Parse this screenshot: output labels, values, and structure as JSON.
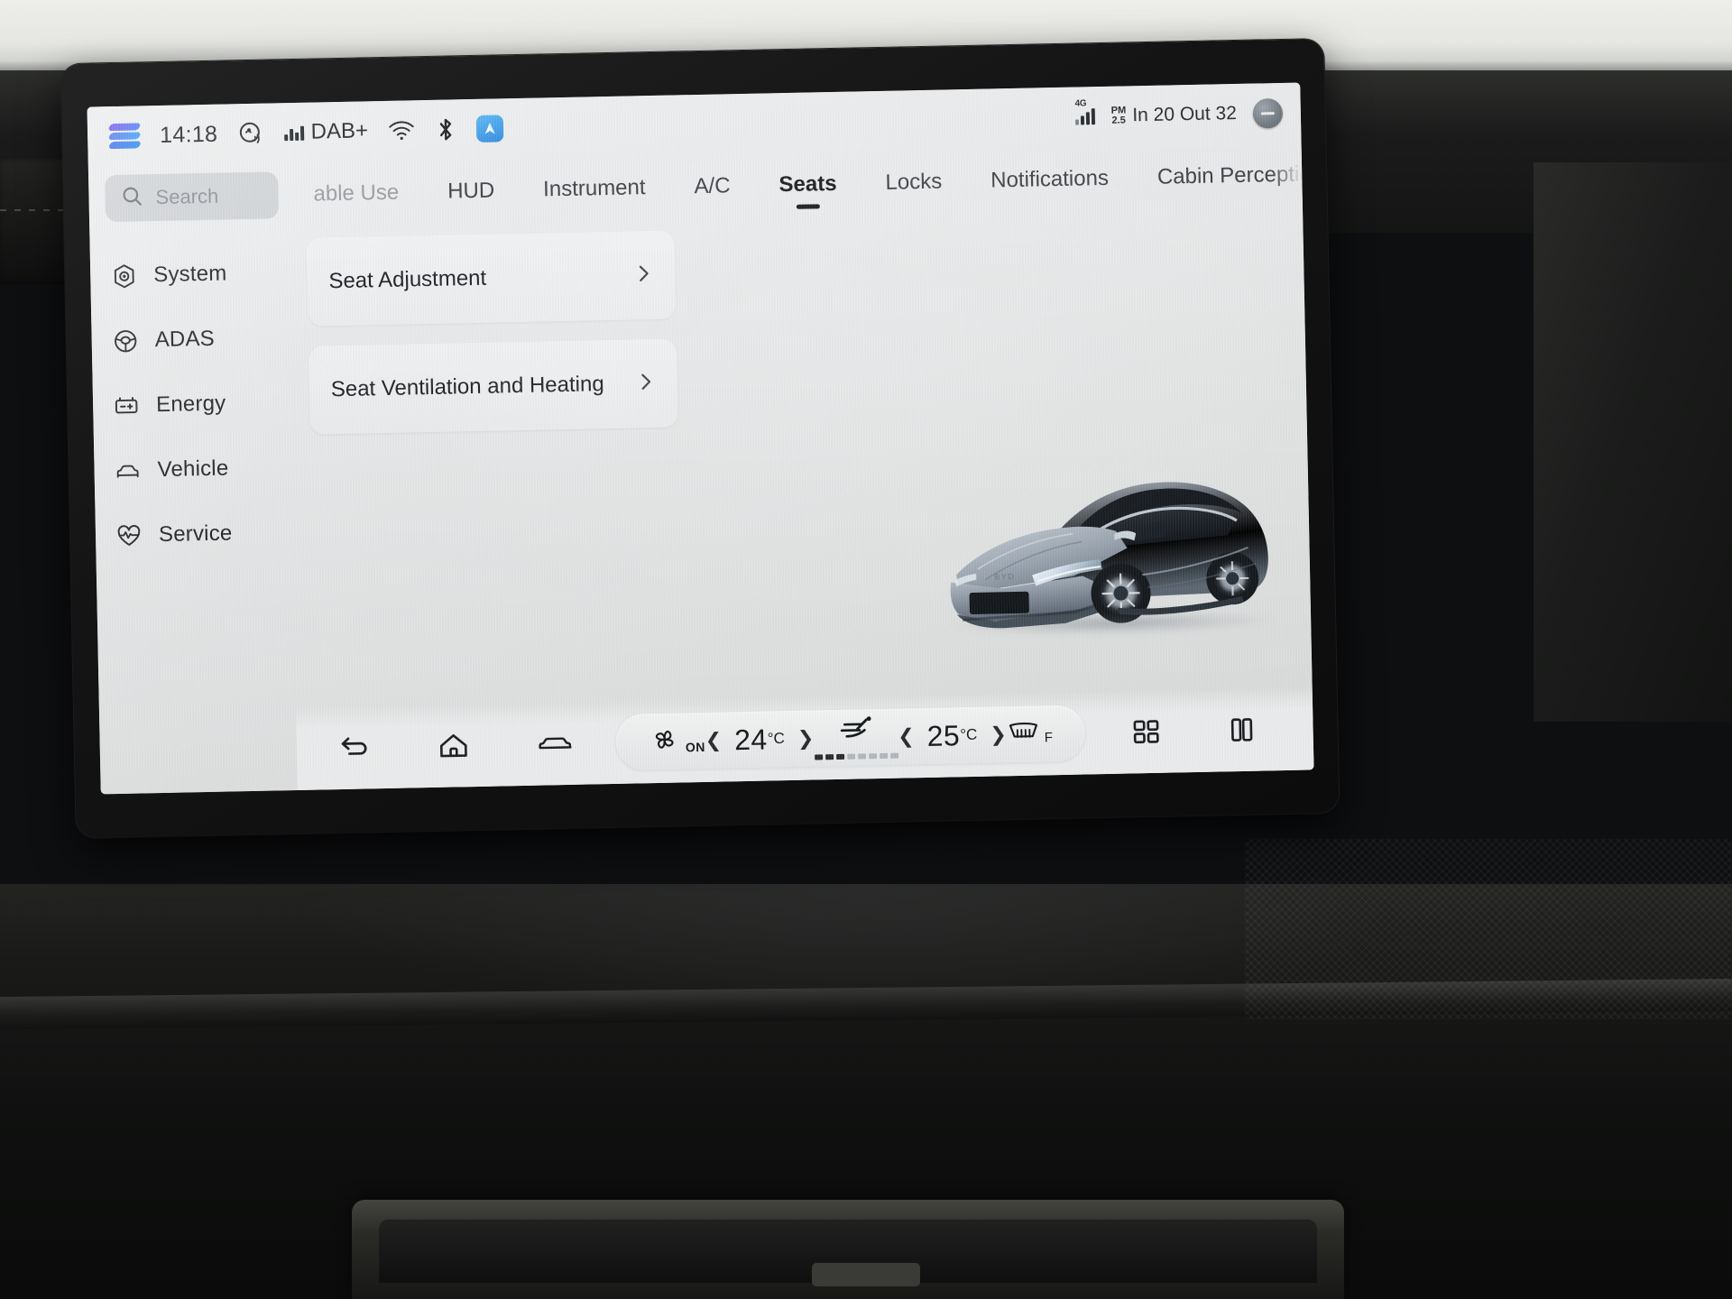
{
  "statusbar": {
    "logo_icon": "brand-logo-icon",
    "time": "14:18",
    "sound_icon": "sound-wave-icon",
    "radio_band": "DAB+",
    "radio_signal_icon": "signal-bars-icon",
    "wifi_icon": "wifi-icon",
    "bluetooth_icon": "bluetooth-icon",
    "app_icon": "navigation-app-icon",
    "network_label": "4G",
    "network_icon": "cellular-signal-icon",
    "pm_label_top": "PM",
    "pm_label_bottom": "2.5",
    "air_quality": "In 20  Out 32",
    "minimize_icon": "minimize-icon"
  },
  "sidebar": {
    "search": {
      "placeholder": "Search",
      "icon": "search-icon"
    },
    "items": [
      {
        "label": "System",
        "icon": "system-gear-icon"
      },
      {
        "label": "ADAS",
        "icon": "steering-wheel-icon"
      },
      {
        "label": "Energy",
        "icon": "battery-icon"
      },
      {
        "label": "Vehicle",
        "icon": "car-front-icon"
      },
      {
        "label": "Service",
        "icon": "heartbeat-icon"
      }
    ],
    "active_item": "Vehicle"
  },
  "tabs": {
    "items": [
      {
        "label": "able Use",
        "active": false,
        "clipped": true
      },
      {
        "label": "HUD",
        "active": false
      },
      {
        "label": "Instrument",
        "active": false
      },
      {
        "label": "A/C",
        "active": false
      },
      {
        "label": "Seats",
        "active": true
      },
      {
        "label": "Locks",
        "active": false
      },
      {
        "label": "Notifications",
        "active": false
      },
      {
        "label": "Cabin Perceptio",
        "active": false,
        "clipped": true
      }
    ]
  },
  "main": {
    "cards": [
      {
        "title": "Seat Adjustment",
        "chevron_icon": "chevron-right-icon"
      },
      {
        "title": "Seat Ventilation and Heating",
        "chevron_icon": "chevron-right-icon"
      }
    ],
    "vehicle_image": {
      "name": "byd-suv-render",
      "badge": "BYD",
      "color": "#96a0ab"
    }
  },
  "bottombar": {
    "back_icon": "back-arrow-icon",
    "home_icon": "home-icon",
    "car_icon": "car-front-icon",
    "fan_icon": "fan-icon",
    "fan_state": "ON",
    "driver_temp": "24",
    "driver_temp_unit": "°C",
    "passenger_temp": "25",
    "passenger_temp_unit": "°C",
    "decrease_icon": "chevron-left-icon",
    "increase_icon": "chevron-right-icon",
    "seat_vent_icon": "seat-ventilation-icon",
    "seat_vent_level": 3,
    "seat_vent_level_max": 8,
    "defrost_icon": "front-defrost-icon",
    "defrost_label": "F",
    "apps_icon": "apps-grid-icon",
    "split_screen_icon": "split-screen-icon",
    "cast_icon": "screen-cast-icon"
  },
  "colors": {
    "accent": "#2f7ef0",
    "screen_bg": "#e9eaec",
    "text": "#1d1f23",
    "muted": "#8d9298"
  }
}
